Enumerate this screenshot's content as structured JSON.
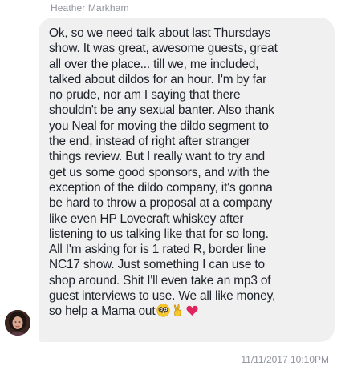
{
  "sender": {
    "name": "Heather Markham"
  },
  "message": {
    "lines": [
      "Ok, so we need talk about last Thursdays",
      "show. It was great, awesome guests, great",
      "all over the place... till we, me included,",
      "talked about dildos for an hour. I'm by far",
      "no prude, nor am I saying that there",
      "shouldn't be any sexual banter. Also thank",
      "you Neal for moving the dildo segment to",
      "the end, instead of right after stranger",
      "things review. But I really want to try and",
      "get us some good sponsors, and with the",
      "exception of the dildo company, it's gonna",
      "be hard to throw a proposal at a company",
      "like even HP Lovecraft whiskey after",
      "listening to us talking like that for so long.",
      "All I'm asking for is 1 rated R, border line",
      "NC17 show. Just something I can use to",
      "shop around. Shit I'll even take an mp3 of",
      "guest interviews to use. We all like money,"
    ],
    "last_line": "so help a Mama out",
    "emojis": [
      "nerd-face-icon",
      "victory-hand-icon",
      "red-heart-icon"
    ]
  },
  "timestamp": "11/11/2017 10:10PM",
  "colors": {
    "bubble": "#f1f0f0",
    "text": "#1d2129",
    "meta": "#90949c",
    "heart": "#e0245e"
  }
}
